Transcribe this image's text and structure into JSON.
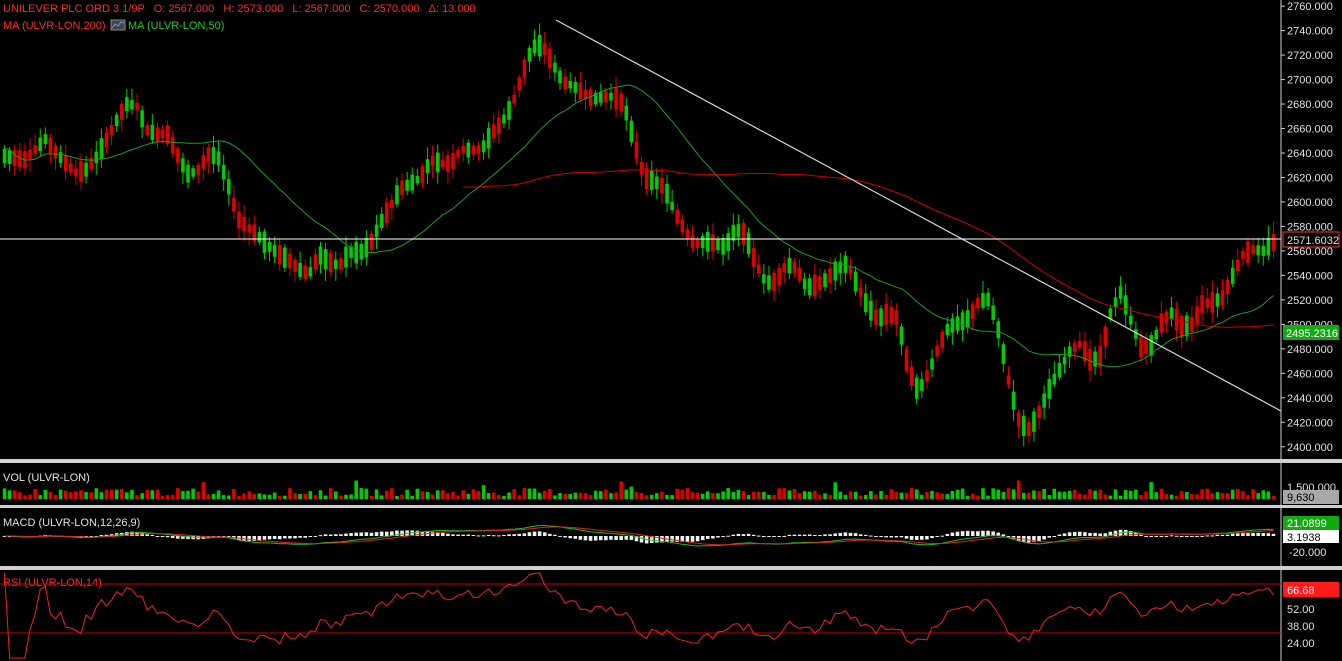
{
  "header": {
    "instrument": "UNILEVER PLC ORD 3 1/9P",
    "open": "O: 2567.000",
    "high": "H: 2573.000",
    "low": "L: 2567.000",
    "close": "C: 2570.000",
    "change": "Δ: 13.000",
    "ma200_label": "MA (ULVR-LON,200)",
    "ma50_label": "MA (ULVR-LON,50)"
  },
  "panels": {
    "volume_label": "VOL (ULVR-LON)",
    "volume_tick": "1,500,000",
    "volume_value": "9,630",
    "macd_label": "MACD (ULVR-LON,12,26,9)",
    "macd_value1": "21.0899",
    "macd_value2": "3.1938",
    "macd_tick": "-20.000",
    "rsi_label": "RSI (ULVR-LON,14)",
    "rsi_value": "66.68",
    "rsi_ticks": [
      "52.00",
      "38.00",
      "24.00"
    ]
  },
  "price_badges": {
    "last": "2571.6032",
    "ma50": "2495.2316"
  },
  "colors": {
    "up": "#00cc00",
    "down": "#dd0000",
    "ma200": "#cc0000",
    "ma50": "#1f9a1f",
    "trendline": "#cccccc",
    "grid_line": "#ffffff"
  },
  "chart_data": {
    "type": "candlestick",
    "title": "UNILEVER PLC ORD 3 1/9P",
    "ylim": [
      2390,
      2765
    ],
    "yticks": [
      "2760.000",
      "2740.000",
      "2720.000",
      "2700.000",
      "2680.000",
      "2660.000",
      "2640.000",
      "2620.000",
      "2600.000",
      "2580.000",
      "2560.000",
      "2540.000",
      "2520.000",
      "2500.000",
      "2480.000",
      "2460.000",
      "2440.000",
      "2420.000",
      "2400.000"
    ],
    "price_guide": [
      [
        2645,
        2630,
        2648,
        2632
      ],
      [
        2632,
        2640,
        2652,
        2626
      ],
      [
        2641,
        2628,
        2646,
        2620
      ],
      [
        2630,
        2655,
        2665,
        2626
      ],
      [
        2655,
        2648,
        2668,
        2640
      ],
      [
        2646,
        2636,
        2652,
        2628
      ],
      [
        2636,
        2628,
        2642,
        2622
      ],
      [
        2630,
        2618,
        2636,
        2612
      ],
      [
        2620,
        2632,
        2640,
        2614
      ],
      [
        2632,
        2640,
        2648,
        2626
      ],
      [
        2640,
        2660,
        2672,
        2636
      ],
      [
        2660,
        2672,
        2682,
        2654
      ],
      [
        2672,
        2688,
        2716,
        2668
      ],
      [
        2688,
        2670,
        2696,
        2660
      ],
      [
        2670,
        2648,
        2676,
        2636
      ],
      [
        2648,
        2662,
        2670,
        2642
      ],
      [
        2662,
        2650,
        2668,
        2640
      ],
      [
        2650,
        2628,
        2656,
        2620
      ],
      [
        2628,
        2618,
        2636,
        2610
      ],
      [
        2618,
        2632,
        2640,
        2612
      ],
      [
        2632,
        2645,
        2650,
        2626
      ],
      [
        2645,
        2630,
        2652,
        2622
      ],
      [
        2630,
        2600,
        2636,
        2592
      ],
      [
        2600,
        2572,
        2606,
        2560
      ],
      [
        2572,
        2586,
        2592,
        2560
      ],
      [
        2586,
        2558,
        2592,
        2548
      ],
      [
        2558,
        2570,
        2578,
        2544
      ],
      [
        2570,
        2545,
        2576,
        2532
      ],
      [
        2545,
        2560,
        2568,
        2520
      ],
      [
        2560,
        2530,
        2566,
        2512
      ],
      [
        2530,
        2552,
        2560,
        2524
      ],
      [
        2552,
        2562,
        2570,
        2540
      ],
      [
        2562,
        2540,
        2568,
        2528
      ],
      [
        2540,
        2556,
        2562,
        2530
      ],
      [
        2556,
        2562,
        2570,
        2548
      ],
      [
        2562,
        2555,
        2566,
        2548
      ],
      [
        2555,
        2575,
        2582,
        2550
      ],
      [
        2575,
        2590,
        2598,
        2568
      ],
      [
        2590,
        2602,
        2610,
        2584
      ],
      [
        2602,
        2620,
        2628,
        2596
      ],
      [
        2620,
        2610,
        2630,
        2600
      ],
      [
        2610,
        2630,
        2638,
        2604
      ],
      [
        2630,
        2638,
        2646,
        2622
      ],
      [
        2638,
        2625,
        2642,
        2616
      ],
      [
        2625,
        2638,
        2648,
        2620
      ],
      [
        2638,
        2648,
        2656,
        2632
      ],
      [
        2648,
        2636,
        2654,
        2628
      ],
      [
        2636,
        2650,
        2660,
        2630
      ],
      [
        2650,
        2662,
        2670,
        2644
      ],
      [
        2662,
        2668,
        2680,
        2656
      ],
      [
        2668,
        2690,
        2700,
        2662
      ],
      [
        2690,
        2718,
        2728,
        2684
      ],
      [
        2718,
        2736,
        2744,
        2712
      ],
      [
        2736,
        2720,
        2750,
        2712
      ],
      [
        2720,
        2706,
        2728,
        2696
      ],
      [
        2706,
        2690,
        2712,
        2676
      ],
      [
        2690,
        2700,
        2710,
        2680
      ],
      [
        2700,
        2678,
        2706,
        2664
      ],
      [
        2678,
        2690,
        2698,
        2670
      ],
      [
        2690,
        2682,
        2704,
        2676
      ],
      [
        2682,
        2690,
        2698,
        2674
      ],
      [
        2690,
        2670,
        2696,
        2660
      ],
      [
        2670,
        2630,
        2676,
        2620
      ],
      [
        2630,
        2610,
        2636,
        2590
      ],
      [
        2610,
        2624,
        2632,
        2600
      ],
      [
        2624,
        2600,
        2630,
        2590
      ],
      [
        2600,
        2584,
        2608,
        2576
      ],
      [
        2584,
        2570,
        2590,
        2560
      ],
      [
        2570,
        2560,
        2576,
        2548
      ],
      [
        2560,
        2576,
        2584,
        2552
      ],
      [
        2576,
        2556,
        2582,
        2548
      ],
      [
        2556,
        2570,
        2578,
        2548
      ],
      [
        2570,
        2586,
        2592,
        2562
      ],
      [
        2586,
        2560,
        2592,
        2552
      ],
      [
        2560,
        2540,
        2566,
        2532
      ],
      [
        2540,
        2528,
        2546,
        2520
      ],
      [
        2528,
        2542,
        2550,
        2522
      ],
      [
        2542,
        2556,
        2566,
        2534
      ],
      [
        2556,
        2536,
        2562,
        2528
      ],
      [
        2536,
        2524,
        2540,
        2516
      ],
      [
        2524,
        2540,
        2548,
        2518
      ],
      [
        2540,
        2534,
        2546,
        2526
      ],
      [
        2534,
        2556,
        2566,
        2530
      ],
      [
        2556,
        2544,
        2562,
        2534
      ],
      [
        2544,
        2520,
        2550,
        2508
      ],
      [
        2520,
        2510,
        2528,
        2478
      ],
      [
        2510,
        2498,
        2516,
        2460
      ],
      [
        2498,
        2520,
        2546,
        2490
      ],
      [
        2520,
        2490,
        2526,
        2470
      ],
      [
        2490,
        2440,
        2498,
        2420
      ],
      [
        2440,
        2450,
        2458,
        2430
      ],
      [
        2450,
        2470,
        2478,
        2444
      ],
      [
        2470,
        2492,
        2500,
        2464
      ],
      [
        2492,
        2504,
        2512,
        2486
      ],
      [
        2504,
        2498,
        2510,
        2488
      ],
      [
        2498,
        2512,
        2520,
        2492
      ],
      [
        2512,
        2526,
        2536,
        2504
      ],
      [
        2526,
        2515,
        2532,
        2506
      ],
      [
        2515,
        2470,
        2520,
        2440
      ],
      [
        2470,
        2430,
        2476,
        2412
      ],
      [
        2430,
        2408,
        2436,
        2400
      ],
      [
        2408,
        2420,
        2428,
        2402
      ],
      [
        2420,
        2440,
        2448,
        2414
      ],
      [
        2440,
        2458,
        2466,
        2432
      ],
      [
        2458,
        2470,
        2478,
        2450
      ],
      [
        2470,
        2488,
        2496,
        2462
      ],
      [
        2488,
        2480,
        2494,
        2474
      ],
      [
        2480,
        2460,
        2486,
        2450
      ],
      [
        2460,
        2488,
        2496,
        2454
      ],
      [
        2488,
        2534,
        2540,
        2484
      ],
      [
        2534,
        2520,
        2540,
        2512
      ],
      [
        2520,
        2484,
        2526,
        2476
      ],
      [
        2484,
        2476,
        2490,
        2470
      ],
      [
        2476,
        2490,
        2498,
        2470
      ],
      [
        2490,
        2514,
        2520,
        2484
      ],
      [
        2514,
        2505,
        2520,
        2496
      ],
      [
        2505,
        2490,
        2512,
        2484
      ],
      [
        2490,
        2510,
        2518,
        2484
      ],
      [
        2510,
        2524,
        2532,
        2504
      ],
      [
        2524,
        2512,
        2530,
        2504
      ],
      [
        2512,
        2532,
        2540,
        2508
      ],
      [
        2532,
        2548,
        2556,
        2526
      ],
      [
        2548,
        2566,
        2574,
        2542
      ],
      [
        2566,
        2556,
        2572,
        2548
      ],
      [
        2556,
        2564,
        2570,
        2552
      ],
      [
        2564,
        2570,
        2573,
        2558
      ]
    ],
    "series": [
      {
        "name": "MA (ULVR-LON,200)",
        "type": "line"
      },
      {
        "name": "MA (ULVR-LON,50)",
        "type": "line"
      }
    ]
  }
}
